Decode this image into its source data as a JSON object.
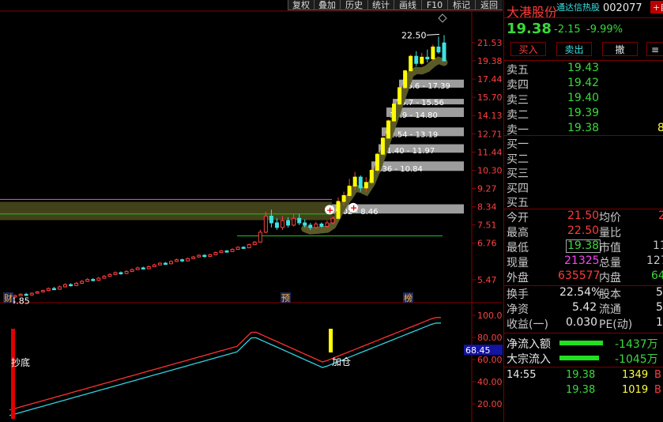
{
  "toolbar": {
    "items": [
      "复权",
      "叠加",
      "历史",
      "统计",
      "画线",
      "F10",
      "标记",
      "返回"
    ]
  },
  "stock": {
    "name": "大港股份",
    "board": "通达信热股",
    "code": "002077",
    "price": "19.38",
    "change": "-2.15",
    "pct": "-9.99%",
    "corner": "+自"
  },
  "trade_buttons": {
    "buy": "买入",
    "sell": "卖出",
    "cancel": "撤",
    "more": "≡"
  },
  "order_book": {
    "sells": [
      {
        "label": "卖五",
        "price": "19.43",
        "vol": ""
      },
      {
        "label": "卖四",
        "price": "19.42",
        "vol": ""
      },
      {
        "label": "卖三",
        "price": "19.40",
        "vol": ""
      },
      {
        "label": "卖二",
        "price": "19.39",
        "vol": ""
      },
      {
        "label": "卖一",
        "price": "19.38",
        "vol": "8"
      }
    ],
    "buys": [
      {
        "label": "买一"
      },
      {
        "label": "买二"
      },
      {
        "label": "买三"
      },
      {
        "label": "买四"
      },
      {
        "label": "买五"
      }
    ]
  },
  "quote": {
    "open_label": "今开",
    "open": "21.50",
    "avg_label": "均价",
    "avg": "2",
    "high_label": "最高",
    "high": "22.50",
    "ratio_label": "量比",
    "ratio": "",
    "low_label": "最低",
    "low": "19.38",
    "mcap_label": "市值",
    "mcap": "11",
    "vol_now_label": "现量",
    "vol_now": "21325",
    "vol_total_label": "总量",
    "vol_total": "127",
    "outer_label": "外盘",
    "outer": "635577",
    "inner_label": "内盘",
    "inner": "64",
    "turnover_label": "换手",
    "turnover": "22.54%",
    "equity_label": "股本",
    "equity": "5",
    "net_label": "净资",
    "net": "5.42",
    "float_label": "流通",
    "float": "5",
    "eps_label": "收益(一)",
    "eps": "0.030",
    "pe_label": "PE(动)",
    "pe": "1"
  },
  "flows": {
    "net_label": "净流入额",
    "net_value": "-1437万",
    "block_label": "大宗流入",
    "block_value": "-1045万"
  },
  "ticks": [
    {
      "time": "14:55",
      "price": "19.38",
      "vol": "1349",
      "side": "B"
    },
    {
      "time": "",
      "price": "19.38",
      "vol": "1019",
      "side": "B"
    }
  ],
  "chart_data": {
    "type": "candlestick",
    "y_ticks": [
      "21.53",
      "19.38",
      "17.44",
      "15.70",
      "14.13",
      "12.71",
      "11.44",
      "10.30",
      "9.27",
      "8.34",
      "7.51",
      "6.76",
      "5.47"
    ],
    "indicator_ticks": [
      "100.0",
      "80.00",
      "60.00",
      "40.00",
      "20.00"
    ],
    "indicator_current": "68.45",
    "price_annotations": {
      "high": "22.50",
      "low": "4.85"
    },
    "event_markers": [
      "财",
      "预",
      "榜"
    ],
    "signals": {
      "bottom": "抄底",
      "add": "加仓"
    },
    "chip_zones": [
      "16.6 - 17.39",
      "15.7 - 15.56",
      "13.9 - 14.80",
      "12.54 - 13.19",
      "11.40 - 11.97",
      "9.36 - 10.84",
      "8.02 - 8.46"
    ],
    "candles": [
      {
        "o": 4.9,
        "c": 4.96,
        "h": 5.0,
        "l": 4.85
      },
      {
        "o": 4.95,
        "c": 4.99,
        "h": 5.02,
        "l": 4.92
      },
      {
        "o": 4.99,
        "c": 5.03,
        "h": 5.06,
        "l": 4.97
      },
      {
        "o": 5.03,
        "c": 5.01,
        "h": 5.07,
        "l": 4.98
      },
      {
        "o": 5.01,
        "c": 5.06,
        "h": 5.09,
        "l": 4.99
      },
      {
        "o": 5.06,
        "c": 5.1,
        "h": 5.13,
        "l": 5.04
      },
      {
        "o": 5.1,
        "c": 5.14,
        "h": 5.17,
        "l": 5.08
      },
      {
        "o": 5.14,
        "c": 5.2,
        "h": 5.23,
        "l": 5.12
      },
      {
        "o": 5.2,
        "c": 5.18,
        "h": 5.25,
        "l": 5.15
      },
      {
        "o": 5.18,
        "c": 5.25,
        "h": 5.29,
        "l": 5.16
      },
      {
        "o": 5.25,
        "c": 5.32,
        "h": 5.36,
        "l": 5.23
      },
      {
        "o": 5.32,
        "c": 5.29,
        "h": 5.36,
        "l": 5.26
      },
      {
        "o": 5.29,
        "c": 5.36,
        "h": 5.4,
        "l": 5.27
      },
      {
        "o": 5.36,
        "c": 5.42,
        "h": 5.46,
        "l": 5.34
      },
      {
        "o": 5.42,
        "c": 5.48,
        "h": 5.52,
        "l": 5.4
      },
      {
        "o": 5.48,
        "c": 5.45,
        "h": 5.52,
        "l": 5.42
      },
      {
        "o": 5.45,
        "c": 5.52,
        "h": 5.56,
        "l": 5.43
      },
      {
        "o": 5.52,
        "c": 5.58,
        "h": 5.62,
        "l": 5.5
      },
      {
        "o": 5.58,
        "c": 5.64,
        "h": 5.68,
        "l": 5.56
      },
      {
        "o": 5.64,
        "c": 5.7,
        "h": 5.74,
        "l": 5.62
      },
      {
        "o": 5.7,
        "c": 5.67,
        "h": 5.74,
        "l": 5.63
      },
      {
        "o": 5.67,
        "c": 5.74,
        "h": 5.78,
        "l": 5.65
      },
      {
        "o": 5.74,
        "c": 5.8,
        "h": 5.84,
        "l": 5.72
      },
      {
        "o": 5.8,
        "c": 5.86,
        "h": 5.9,
        "l": 5.78
      },
      {
        "o": 5.86,
        "c": 5.83,
        "h": 5.9,
        "l": 5.8
      },
      {
        "o": 5.83,
        "c": 5.9,
        "h": 5.94,
        "l": 5.81
      },
      {
        "o": 5.9,
        "c": 5.96,
        "h": 6.0,
        "l": 5.88
      },
      {
        "o": 5.96,
        "c": 6.02,
        "h": 6.06,
        "l": 5.94
      },
      {
        "o": 6.02,
        "c": 6.0,
        "h": 6.06,
        "l": 5.96
      },
      {
        "o": 6.0,
        "c": 6.08,
        "h": 6.12,
        "l": 5.98
      },
      {
        "o": 6.08,
        "c": 6.14,
        "h": 6.18,
        "l": 6.06
      },
      {
        "o": 6.14,
        "c": 6.1,
        "h": 6.18,
        "l": 6.06
      },
      {
        "o": 6.1,
        "c": 6.18,
        "h": 6.22,
        "l": 6.08
      },
      {
        "o": 6.18,
        "c": 6.24,
        "h": 6.28,
        "l": 6.16
      },
      {
        "o": 6.24,
        "c": 6.3,
        "h": 6.34,
        "l": 6.22
      },
      {
        "o": 6.3,
        "c": 6.26,
        "h": 6.34,
        "l": 6.22
      },
      {
        "o": 6.26,
        "c": 6.32,
        "h": 6.36,
        "l": 6.24
      },
      {
        "o": 6.32,
        "c": 6.4,
        "h": 6.44,
        "l": 6.3
      },
      {
        "o": 6.4,
        "c": 6.46,
        "h": 6.5,
        "l": 6.38
      },
      {
        "o": 6.46,
        "c": 6.44,
        "h": 6.5,
        "l": 6.4
      },
      {
        "o": 6.44,
        "c": 6.52,
        "h": 6.56,
        "l": 6.42
      },
      {
        "o": 6.52,
        "c": 6.6,
        "h": 6.64,
        "l": 6.5
      },
      {
        "o": 6.6,
        "c": 6.58,
        "h": 6.64,
        "l": 6.54
      },
      {
        "o": 6.58,
        "c": 6.7,
        "h": 6.74,
        "l": 6.56
      },
      {
        "o": 6.7,
        "c": 6.8,
        "h": 6.84,
        "l": 6.68
      },
      {
        "o": 6.8,
        "c": 7.2,
        "h": 7.3,
        "l": 6.78
      },
      {
        "o": 7.2,
        "c": 7.9,
        "h": 8.1,
        "l": 7.15
      },
      {
        "o": 7.9,
        "c": 7.6,
        "h": 8.2,
        "l": 7.4
      },
      {
        "o": 7.6,
        "c": 7.4,
        "h": 7.8,
        "l": 7.3
      },
      {
        "o": 7.4,
        "c": 7.7,
        "h": 7.9,
        "l": 7.3
      },
      {
        "o": 7.7,
        "c": 7.5,
        "h": 7.85,
        "l": 7.4
      },
      {
        "o": 7.5,
        "c": 7.8,
        "h": 8.0,
        "l": 7.45
      },
      {
        "o": 7.8,
        "c": 7.6,
        "h": 8.0,
        "l": 7.5
      },
      {
        "o": 7.6,
        "c": 7.5,
        "h": 7.75,
        "l": 7.4
      },
      {
        "o": 7.5,
        "c": 7.4,
        "h": 7.6,
        "l": 7.3
      },
      {
        "o": 7.4,
        "c": 7.55,
        "h": 7.65,
        "l": 7.35
      },
      {
        "o": 7.55,
        "c": 7.45,
        "h": 7.62,
        "l": 7.4
      },
      {
        "o": 7.45,
        "c": 7.6,
        "h": 7.7,
        "l": 7.4
      },
      {
        "o": 7.6,
        "c": 7.8,
        "h": 7.95,
        "l": 7.55
      },
      {
        "o": 7.8,
        "c": 8.6,
        "h": 8.8,
        "l": 7.75
      },
      {
        "o": 8.6,
        "c": 8.9,
        "h": 9.1,
        "l": 8.4
      },
      {
        "o": 8.9,
        "c": 9.4,
        "h": 9.8,
        "l": 8.8
      },
      {
        "o": 9.4,
        "c": 9.9,
        "h": 10.2,
        "l": 9.2
      },
      {
        "o": 9.9,
        "c": 9.3,
        "h": 10.0,
        "l": 9.1
      },
      {
        "o": 9.3,
        "c": 9.6,
        "h": 9.9,
        "l": 9.1
      },
      {
        "o": 9.6,
        "c": 10.3,
        "h": 10.5,
        "l": 9.5
      },
      {
        "o": 10.3,
        "c": 11.3,
        "h": 11.4,
        "l": 10.2
      },
      {
        "o": 11.3,
        "c": 12.4,
        "h": 12.5,
        "l": 11.3
      },
      {
        "o": 12.4,
        "c": 13.7,
        "h": 13.8,
        "l": 12.4
      },
      {
        "o": 13.7,
        "c": 15.1,
        "h": 15.2,
        "l": 13.6
      },
      {
        "o": 15.1,
        "c": 16.6,
        "h": 16.7,
        "l": 15.0
      },
      {
        "o": 16.6,
        "c": 18.3,
        "h": 18.4,
        "l": 16.5
      },
      {
        "o": 18.3,
        "c": 19.9,
        "h": 20.1,
        "l": 18.2
      },
      {
        "o": 19.9,
        "c": 19.1,
        "h": 20.5,
        "l": 18.8
      },
      {
        "o": 19.1,
        "c": 19.8,
        "h": 20.3,
        "l": 18.9
      },
      {
        "o": 19.8,
        "c": 19.6,
        "h": 20.7,
        "l": 19.2
      },
      {
        "o": 19.6,
        "c": 21.0,
        "h": 21.3,
        "l": 19.4
      },
      {
        "o": 21.0,
        "c": 20.4,
        "h": 22.3,
        "l": 20.2
      },
      {
        "o": 21.5,
        "c": 19.38,
        "h": 22.5,
        "l": 19.38
      }
    ]
  }
}
